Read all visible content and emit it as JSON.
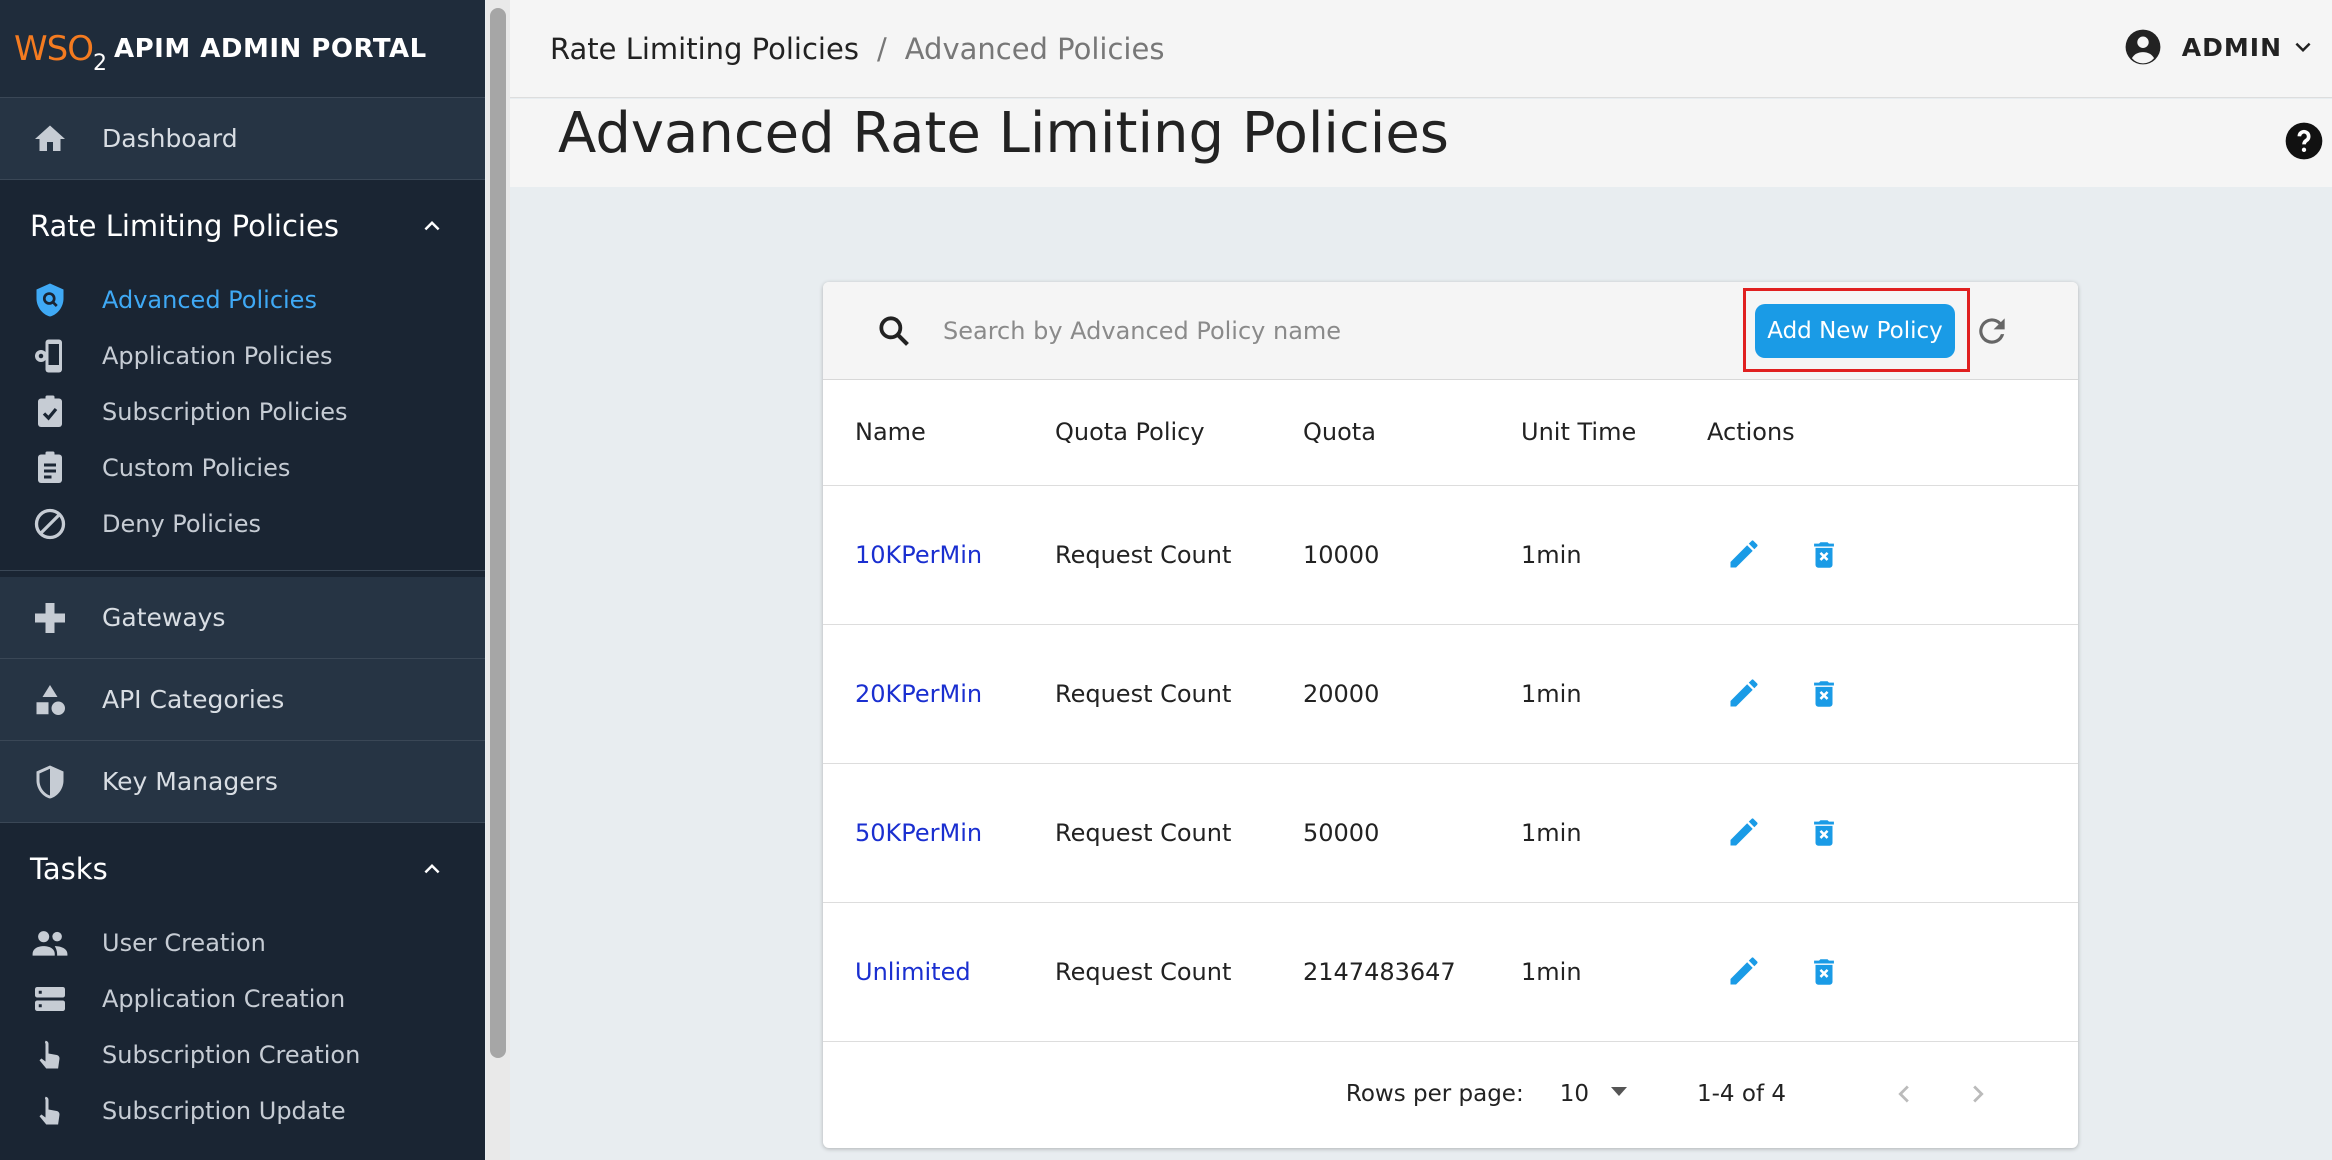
{
  "brand": {
    "logo_text": "WSO",
    "logo_sub": "2",
    "title": "APIM ADMIN PORTAL"
  },
  "sidebar": {
    "dashboard": {
      "label": "Dashboard",
      "icon": "home-icon"
    },
    "rate_limiting": {
      "label": "Rate Limiting Policies",
      "items": [
        {
          "label": "Advanced Policies",
          "icon": "shield-search-icon",
          "active": true
        },
        {
          "label": "Application Policies",
          "icon": "app-settings-icon"
        },
        {
          "label": "Subscription Policies",
          "icon": "clipboard-check-icon"
        },
        {
          "label": "Custom Policies",
          "icon": "clipboard-list-icon"
        },
        {
          "label": "Deny Policies",
          "icon": "block-icon"
        }
      ]
    },
    "gateways": {
      "label": "Gateways",
      "icon": "gateway-icon"
    },
    "api_categories": {
      "label": "API Categories",
      "icon": "category-icon"
    },
    "key_managers": {
      "label": "Key Managers",
      "icon": "key-shield-icon"
    },
    "tasks": {
      "label": "Tasks",
      "items": [
        {
          "label": "User Creation",
          "icon": "people-icon"
        },
        {
          "label": "Application Creation",
          "icon": "storage-icon"
        },
        {
          "label": "Subscription Creation",
          "icon": "touch-icon"
        },
        {
          "label": "Subscription Update",
          "icon": "touch-icon"
        }
      ]
    }
  },
  "breadcrumb": {
    "parent": "Rate Limiting Policies",
    "separator": "/",
    "current": "Advanced Policies"
  },
  "user": {
    "name": "ADMIN"
  },
  "page": {
    "title": "Advanced Rate Limiting Policies"
  },
  "search": {
    "placeholder": "Search by Advanced Policy name",
    "value": ""
  },
  "toolbar": {
    "add_label": "Add New Policy"
  },
  "table": {
    "columns": [
      "Name",
      "Quota Policy",
      "Quota",
      "Unit Time",
      "Actions"
    ],
    "rows": [
      {
        "name": "10KPerMin",
        "quota_policy": "Request Count",
        "quota": "10000",
        "unit_time": "1min"
      },
      {
        "name": "20KPerMin",
        "quota_policy": "Request Count",
        "quota": "20000",
        "unit_time": "1min"
      },
      {
        "name": "50KPerMin",
        "quota_policy": "Request Count",
        "quota": "50000",
        "unit_time": "1min"
      },
      {
        "name": "Unlimited",
        "quota_policy": "Request Count",
        "quota": "2147483647",
        "unit_time": "1min"
      }
    ]
  },
  "pagination": {
    "rows_per_page_label": "Rows per page:",
    "rows_per_page": "10",
    "range": "1-4 of 4"
  },
  "colors": {
    "sidebar_bg": "#1a2533",
    "accent": "#1a9be6",
    "active_nav": "#3fa9f5",
    "link": "#1a2fd0",
    "highlight_frame": "#e02020"
  }
}
